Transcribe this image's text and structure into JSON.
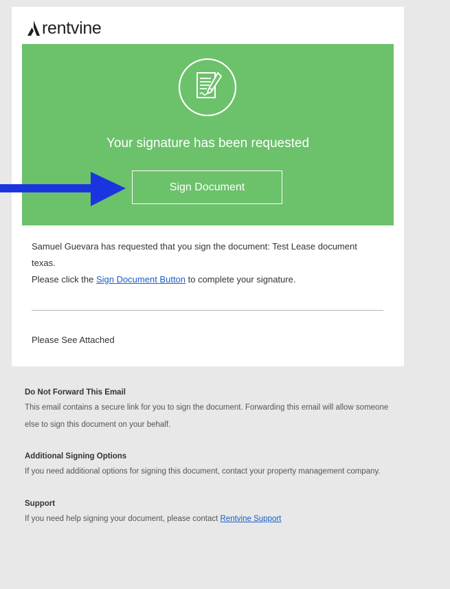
{
  "brand": {
    "name": "rentvine",
    "icon": "rentvine-logo-icon"
  },
  "hero": {
    "icon": "signed-document-icon",
    "title": "Your signature has been requested",
    "button_label": "Sign Document",
    "background": "#6cc16b"
  },
  "message": {
    "line1": "Samuel Guevara has requested that you sign the document: Test Lease document texas.",
    "line2_prefix": "Please click the ",
    "line2_link": "Sign Document Button",
    "line2_suffix": " to complete your signature.",
    "attached": "Please See Attached"
  },
  "footer": {
    "sections": [
      {
        "heading": "Do Not Forward This Email",
        "text": "This email contains a secure link for you to sign the document. Forwarding this email will allow someone else to sign this document on your behalf."
      },
      {
        "heading": "Additional Signing Options",
        "text": "If you need additional options for signing this document, contact your property management company."
      }
    ],
    "support": {
      "heading": "Support",
      "text_prefix": "If you need help signing your document, please contact ",
      "link": "Rentvine Support"
    }
  },
  "annotation": {
    "icon": "pointer-arrow-icon",
    "color": "#1a35e0"
  }
}
